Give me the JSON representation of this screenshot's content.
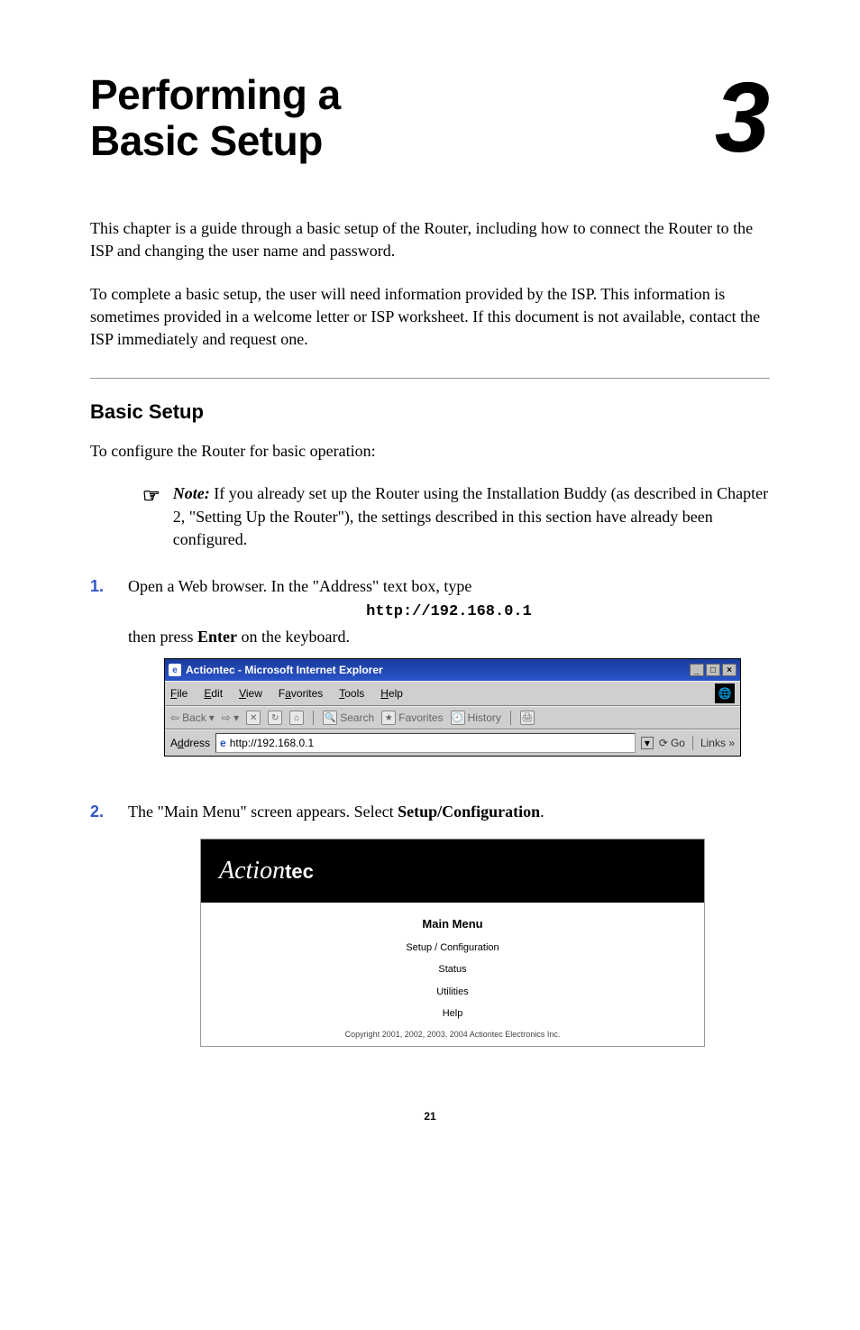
{
  "chapter": {
    "title_line1": "Performing a",
    "title_line2": "Basic Setup",
    "number": "3"
  },
  "paragraphs": {
    "intro1": "This chapter is a guide through a basic setup of the Router, including how to connect the Router to the ISP and changing the user name and password.",
    "intro2": "To complete a basic setup, the user will need information provided by the ISP. This information is sometimes provided in a welcome letter or ISP worksheet. If this document is not available, contact the ISP immediately and request one."
  },
  "section": {
    "heading": "Basic Setup",
    "lead": "To configure the Router for basic operation:"
  },
  "note": {
    "icon": "☞",
    "label": "Note:",
    "text": " If you already set up the Router using the Installation Buddy (as described in Chapter 2, \"Setting Up the Router\"), the settings described in this section have already been configured."
  },
  "steps": {
    "s1_num": "1.",
    "s1_a": "Open a Web browser. In the \"Address\" text box, type",
    "s1_url": "http://192.168.0.1",
    "s1_b_before": "then press ",
    "s1_b_bold": "Enter",
    "s1_b_after": " on the keyboard.",
    "s2_num": "2.",
    "s2_a": "The \"Main Menu\" screen appears. Select ",
    "s2_bold": "Setup/Configuration",
    "s2_after": "."
  },
  "ie": {
    "title": "Actiontec - Microsoft Internet Explorer",
    "menu": {
      "file": "File",
      "edit": "Edit",
      "view": "View",
      "fav": "Favorites",
      "tools": "Tools",
      "help": "Help"
    },
    "toolbar": {
      "back": "Back",
      "search": "Search",
      "favorites": "Favorites",
      "history": "History"
    },
    "addr_label": "Address",
    "addr_value": "http://192.168.0.1",
    "go": "Go",
    "links": "Links »"
  },
  "actiontec": {
    "logo_a": "Action",
    "logo_b": "tec",
    "main": "Main Menu",
    "items": [
      "Setup / Configuration",
      "Status",
      "Utilities",
      "Help"
    ],
    "copyright": "Copyright 2001, 2002, 2003, 2004 Actiontec Electronics Inc."
  },
  "page_number": "21"
}
